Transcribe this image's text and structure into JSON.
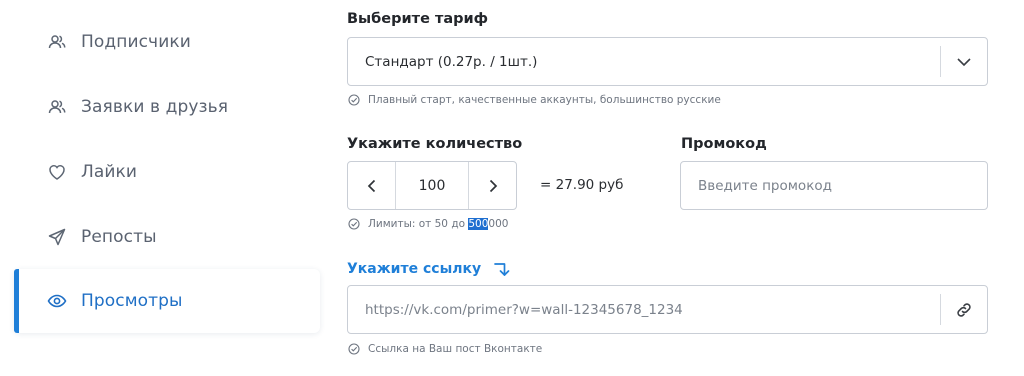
{
  "sidebar": {
    "items": [
      {
        "label": "Подписчики",
        "icon": "users-icon"
      },
      {
        "label": "Заявки в друзья",
        "icon": "users-icon"
      },
      {
        "label": "Лайки",
        "icon": "heart-icon"
      },
      {
        "label": "Репосты",
        "icon": "send-icon"
      },
      {
        "label": "Просмотры",
        "icon": "eye-icon",
        "active": true
      }
    ]
  },
  "tariff": {
    "label": "Выберите тариф",
    "selected": "Стандарт (0.27р. / 1шт.)",
    "hint": "Плавный старт, качественные аккаунты, большинство русские"
  },
  "quantity": {
    "label": "Укажите количество",
    "value": "100",
    "total": "= 27.90 руб",
    "hint_prefix": "Лимиты: от 50 до ",
    "hint_selected": "500",
    "hint_suffix": "000"
  },
  "promo": {
    "label": "Промокод",
    "placeholder": "Введите промокод"
  },
  "link": {
    "label": "Укажите ссылку",
    "placeholder": "https://vk.com/primer?w=wall-12345678_1234",
    "hint": "Ссылка на Ваш пост Вконтакте"
  },
  "colors": {
    "accent": "#1f7fd8",
    "text": "#2a2d31",
    "muted": "#6e7580",
    "border": "#c9ced6"
  }
}
